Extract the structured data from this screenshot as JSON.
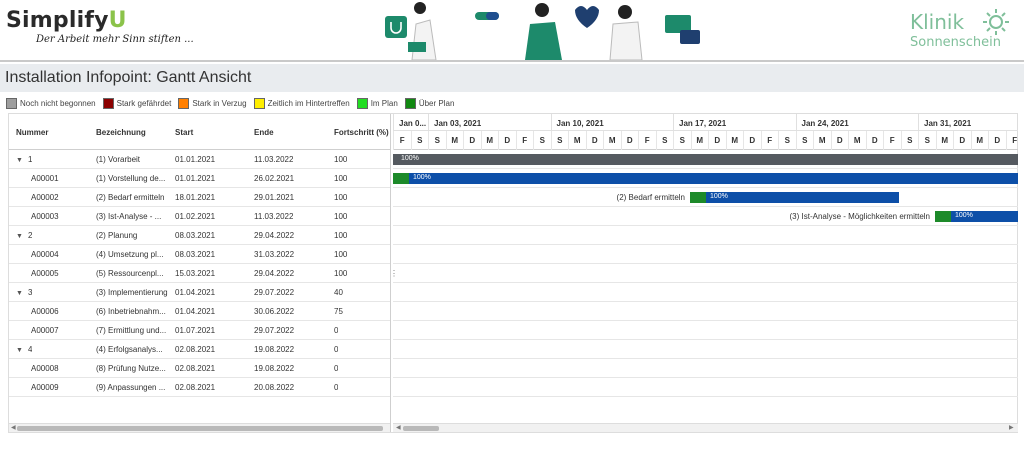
{
  "brand": {
    "name_main": "Simplify",
    "name_accent": "U",
    "tagline": "Der Arbeit mehr Sinn stiften ..."
  },
  "clinic": {
    "line1": "Klinik",
    "line2": "Sonnenschein"
  },
  "page_title": "Installation Infopoint: Gantt Ansicht",
  "legend": [
    {
      "label": "Noch nicht begonnen",
      "color": "#9e9e9e"
    },
    {
      "label": "Stark gefährdet",
      "color": "#8b0000"
    },
    {
      "label": "Stark in Verzug",
      "color": "#ff7f00"
    },
    {
      "label": "Zeitlich im Hintertreffen",
      "color": "#ffee00"
    },
    {
      "label": "Im Plan",
      "color": "#22dd22"
    },
    {
      "label": "Über Plan",
      "color": "#118811"
    }
  ],
  "columns": {
    "nummer": "Nummer",
    "bezeichnung": "Bezeichnung",
    "start": "Start",
    "ende": "Ende",
    "fortschritt": "Fortschritt (%)"
  },
  "rows": [
    {
      "nummer": "1",
      "group": true,
      "bezeichnung": "(1) Vorarbeit",
      "start": "01.01.2021",
      "ende": "11.03.2022",
      "fortschritt": "100"
    },
    {
      "nummer": "A00001",
      "group": false,
      "bezeichnung": "(1) Vorstellung de...",
      "start": "01.01.2021",
      "ende": "26.02.2021",
      "fortschritt": "100"
    },
    {
      "nummer": "A00002",
      "group": false,
      "bezeichnung": "(2) Bedarf ermitteln",
      "start": "18.01.2021",
      "ende": "29.01.2021",
      "fortschritt": "100"
    },
    {
      "nummer": "A00003",
      "group": false,
      "bezeichnung": "(3) Ist-Analyse - ...",
      "start": "01.02.2021",
      "ende": "11.03.2022",
      "fortschritt": "100"
    },
    {
      "nummer": "2",
      "group": true,
      "bezeichnung": "(2) Planung",
      "start": "08.03.2021",
      "ende": "29.04.2022",
      "fortschritt": "100"
    },
    {
      "nummer": "A00004",
      "group": false,
      "bezeichnung": "(4) Umsetzung pl...",
      "start": "08.03.2021",
      "ende": "31.03.2022",
      "fortschritt": "100"
    },
    {
      "nummer": "A00005",
      "group": false,
      "bezeichnung": "(5) Ressourcenpl...",
      "start": "15.03.2021",
      "ende": "29.04.2022",
      "fortschritt": "100"
    },
    {
      "nummer": "3",
      "group": true,
      "bezeichnung": "(3) Implementierung",
      "start": "01.04.2021",
      "ende": "29.07.2022",
      "fortschritt": "40"
    },
    {
      "nummer": "A00006",
      "group": false,
      "bezeichnung": "(6) Inbetriebnahm...",
      "start": "01.04.2021",
      "ende": "30.06.2022",
      "fortschritt": "75"
    },
    {
      "nummer": "A00007",
      "group": false,
      "bezeichnung": "(7) Ermittlung und...",
      "start": "01.07.2021",
      "ende": "29.07.2022",
      "fortschritt": "0"
    },
    {
      "nummer": "4",
      "group": true,
      "bezeichnung": "(4) Erfolgsanalys...",
      "start": "02.08.2021",
      "ende": "19.08.2022",
      "fortschritt": "0"
    },
    {
      "nummer": "A00008",
      "group": false,
      "bezeichnung": "(8) Prüfung Nutze...",
      "start": "02.08.2021",
      "ende": "19.08.2022",
      "fortschritt": "0"
    },
    {
      "nummer": "A00009",
      "group": false,
      "bezeichnung": "(9) Anpassungen ...",
      "start": "02.08.2021",
      "ende": "20.08.2022",
      "fortschritt": "0"
    }
  ],
  "timeline": {
    "weeks": [
      "Jan 0...",
      "Jan 03, 2021",
      "Jan 10, 2021",
      "Jan 17, 2021",
      "Jan 24, 2021",
      "Jan 31, 2021"
    ],
    "days": [
      "F",
      "S",
      "S",
      "M",
      "D",
      "M",
      "D",
      "F",
      "S",
      "S",
      "M",
      "D",
      "M",
      "D",
      "F",
      "S",
      "S",
      "M",
      "D",
      "M",
      "D",
      "F",
      "S",
      "S",
      "M",
      "D",
      "M",
      "D",
      "F",
      "S",
      "S",
      "M",
      "D",
      "M",
      "D",
      "F"
    ],
    "bars": [
      {
        "row": 0,
        "label": "100%",
        "task": "",
        "color": "#555a60",
        "progress_color": "#555a60"
      },
      {
        "row": 1,
        "label": "100%",
        "task": "",
        "color": "#0d4fa8",
        "progress_color": "#1d8a2a"
      },
      {
        "row": 2,
        "label": "100%",
        "task": "(2) Bedarf ermitteln",
        "color": "#0d4fa8",
        "progress_color": "#1d8a2a"
      },
      {
        "row": 3,
        "label": "100%",
        "task": "(3) Ist-Analyse - Möglichkeiten ermitteln",
        "color": "#0d4fa8",
        "progress_color": "#1d8a2a"
      }
    ]
  }
}
